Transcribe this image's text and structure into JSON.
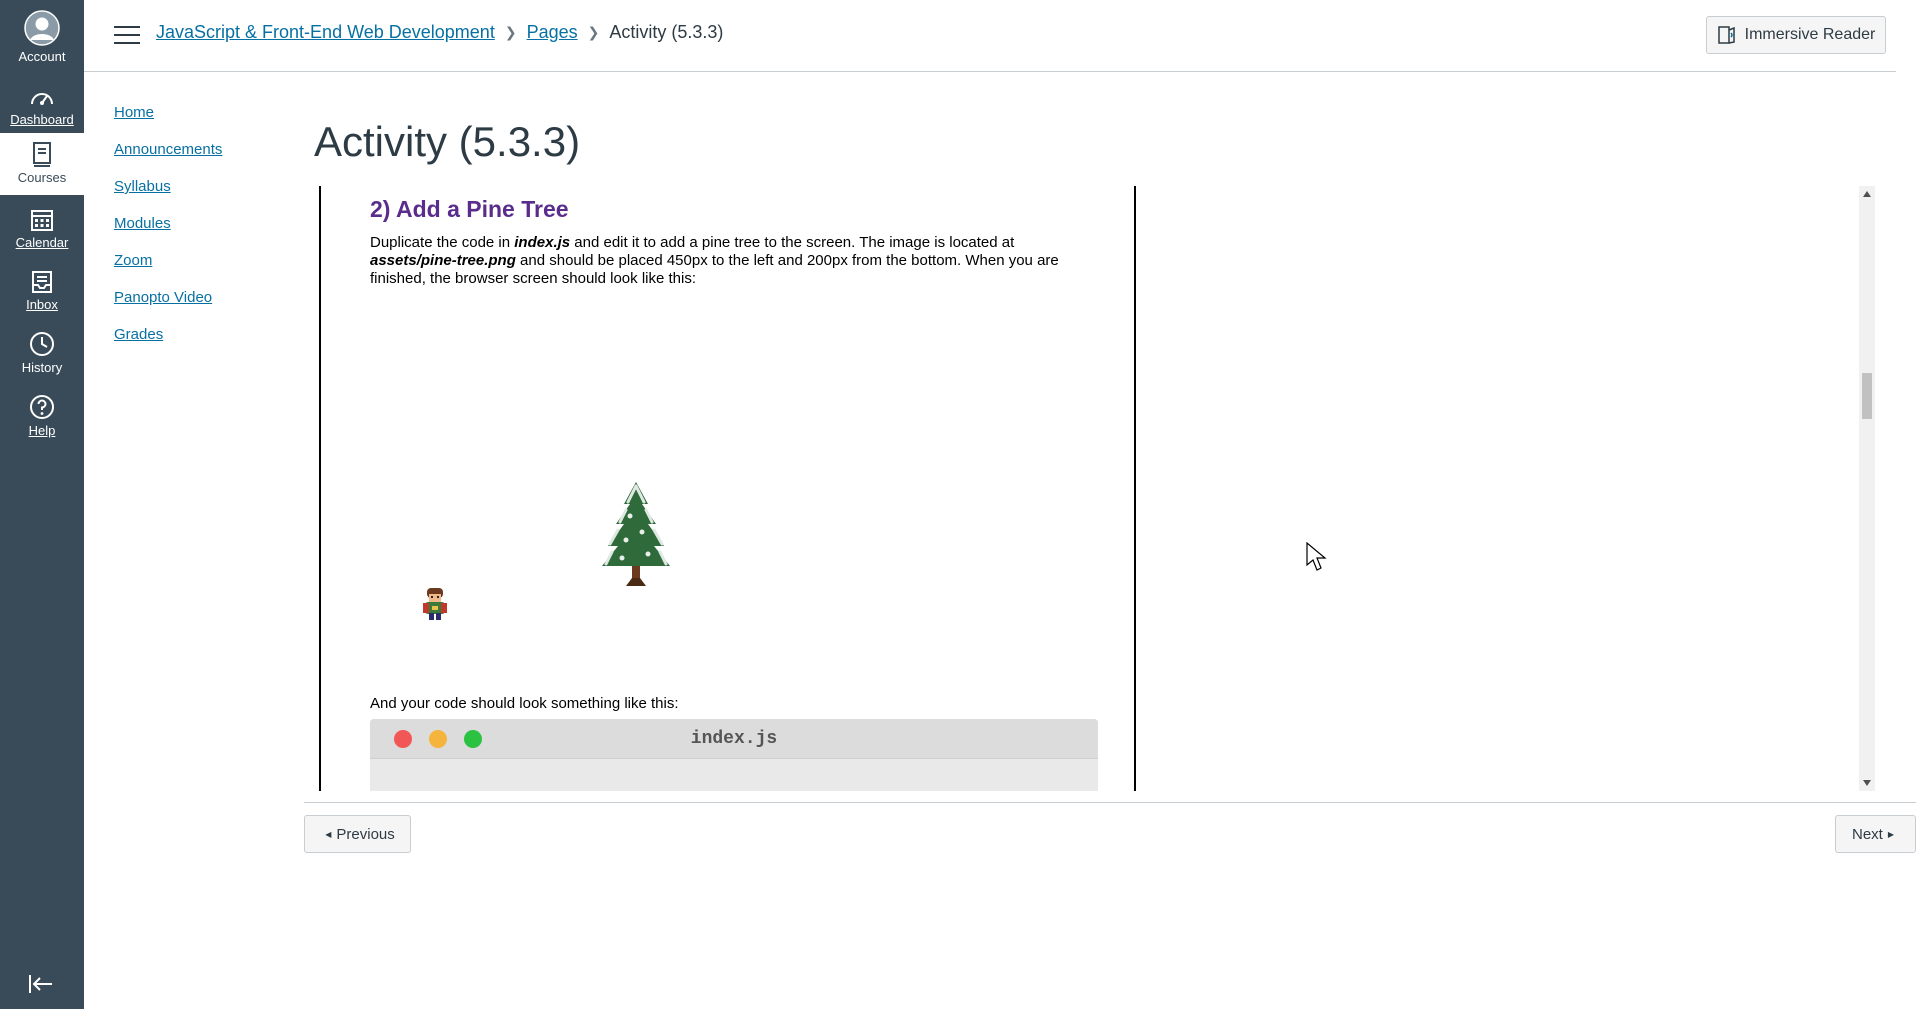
{
  "global_nav": {
    "items": [
      {
        "label": "Account",
        "icon": "account-icon"
      },
      {
        "label": "Dashboard",
        "icon": "dashboard-icon"
      },
      {
        "label": "Courses",
        "icon": "courses-icon"
      },
      {
        "label": "Calendar",
        "icon": "calendar-icon"
      },
      {
        "label": "Inbox",
        "icon": "inbox-icon"
      },
      {
        "label": "History",
        "icon": "history-icon"
      },
      {
        "label": "Help",
        "icon": "help-icon"
      }
    ],
    "active": "Courses",
    "bg_color": "#394b58",
    "collapse_icon": "collapse-nav-icon"
  },
  "header": {
    "breadcrumb": {
      "course": "JavaScript & Front-End Web Development",
      "pages": "Pages",
      "current": "Activity (5.3.3)"
    },
    "immersive_reader_label": "Immersive Reader"
  },
  "course_nav": {
    "items": [
      "Home",
      "Announcements",
      "Syllabus",
      "Modules",
      "Zoom",
      "Panopto Video",
      "Grades"
    ]
  },
  "page": {
    "title": "Activity (5.3.3)",
    "section_heading": "2) Add a Pine Tree",
    "instructions": {
      "t1": "Duplicate the code in ",
      "file1": "index.js",
      "t2": " and edit it to add a pine tree to the screen. The image is located at ",
      "file2": "assets/pine-tree.png",
      "t3": " and should be placed 450px to the left and 200px from the bottom. When you are finished, the browser screen should look like this:"
    },
    "code_intro": "And your code should look something like this:",
    "code_window": {
      "filename": "index.js",
      "dot_colors": [
        "#f25757",
        "#f5b53d",
        "#2bc241"
      ]
    },
    "heading_color": "#5a2d8c"
  },
  "footer": {
    "previous_label": "Previous",
    "next_label": "Next"
  },
  "colors": {
    "link": "#0770a3",
    "text": "#2d3b45"
  }
}
